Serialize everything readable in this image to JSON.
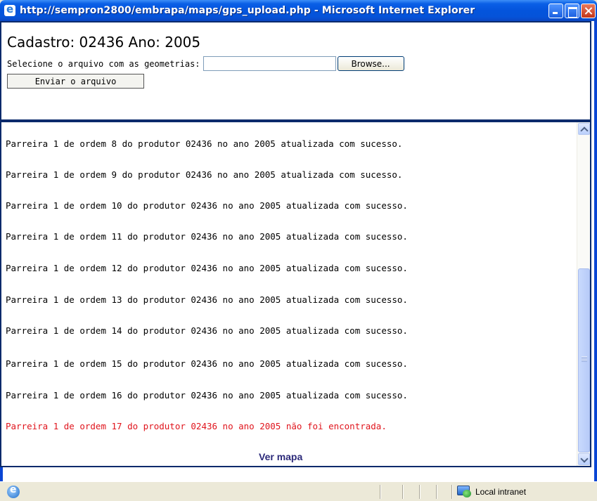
{
  "window": {
    "title": "http://sempron2800/embrapa/maps/gps_upload.php - Microsoft Internet Explorer"
  },
  "form": {
    "heading": "Cadastro: 02436 Ano: 2005",
    "select_label": "Selecione o arquivo com as geometrias:",
    "file_value": "",
    "browse_label": "Browse...",
    "send_label": "Enviar o arquivo"
  },
  "messages": [
    {
      "text": "Parreira 1 de ordem 8 do produtor 02436 no ano 2005 atualizada com sucesso.",
      "status": "success"
    },
    {
      "text": "Parreira 1 de ordem 9 do produtor 02436 no ano 2005 atualizada com sucesso.",
      "status": "success"
    },
    {
      "text": "Parreira 1 de ordem 10 do produtor 02436 no ano 2005 atualizada com sucesso.",
      "status": "success"
    },
    {
      "text": "Parreira 1 de ordem 11 do produtor 02436 no ano 2005 atualizada com sucesso.",
      "status": "success"
    },
    {
      "text": "Parreira 1 de ordem 12 do produtor 02436 no ano 2005 atualizada com sucesso.",
      "status": "success"
    },
    {
      "text": "Parreira 1 de ordem 13 do produtor 02436 no ano 2005 atualizada com sucesso.",
      "status": "success"
    },
    {
      "text": "Parreira 1 de ordem 14 do produtor 02436 no ano 2005 atualizada com sucesso.",
      "status": "success"
    },
    {
      "text": "Parreira 1 de ordem 15 do produtor 02436 no ano 2005 atualizada com sucesso.",
      "status": "success"
    },
    {
      "text": "Parreira 1 de ordem 16 do produtor 02436 no ano 2005 atualizada com sucesso.",
      "status": "success"
    },
    {
      "text": "Parreira 1 de ordem 17 do produtor 02436 no ano 2005 não foi encontrada.",
      "status": "error"
    }
  ],
  "map_link": "Ver mapa",
  "statusbar": {
    "zone": "Local intranet"
  },
  "colors": {
    "titlebar": "#0454dc",
    "error_text": "#e0141c",
    "link": "#2c2a7a"
  },
  "icons": {
    "title": "ie-page-icon",
    "status_page": "ie-page-icon",
    "zone": "local-intranet-icon"
  }
}
